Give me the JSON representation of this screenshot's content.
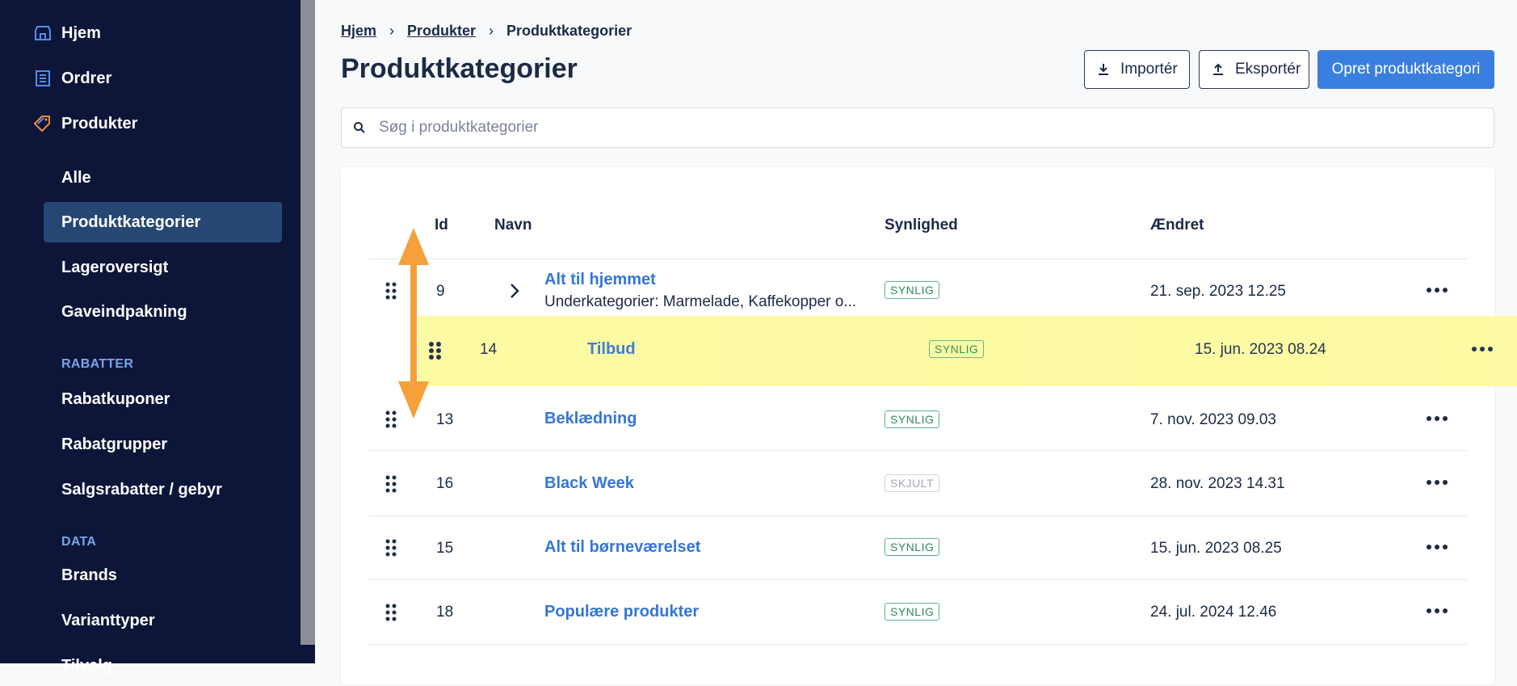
{
  "sidebar": {
    "nav": [
      {
        "label": "Hjem",
        "icon": "store-icon"
      },
      {
        "label": "Ordrer",
        "icon": "orders-icon"
      },
      {
        "label": "Produkter",
        "icon": "tag-icon"
      }
    ],
    "sub": [
      "Alle",
      "Produktkategorier",
      "Lageroversigt",
      "Gaveindpakning"
    ],
    "section_rabatter": "RABATTER",
    "rabatter": [
      "Rabatkuponer",
      "Rabatgrupper",
      "Salgsrabatter / gebyr"
    ],
    "section_data": "DATA",
    "data": [
      "Brands",
      "Varianttyper",
      "Tilvalg"
    ]
  },
  "breadcrumb": {
    "home": "Hjem",
    "products": "Produkter",
    "current": "Produktkategorier"
  },
  "page": {
    "title": "Produktkategorier",
    "import_label": "Importér",
    "export_label": "Eksportér",
    "create_label": "Opret produktkategori"
  },
  "search": {
    "placeholder": "Søg i produktkategorier"
  },
  "table": {
    "headers": {
      "id": "Id",
      "name": "Navn",
      "visibility": "Synlighed",
      "changed": "Ændret"
    },
    "rows": [
      {
        "id": "9",
        "name": "Alt til hjemmet",
        "sub": "Underkategorier: Marmelade, Kaffekopper o...",
        "visibility": "SYNLIG",
        "changed": "21. sep. 2023 12.25"
      },
      {
        "id": "13",
        "name": "Beklædning",
        "visibility": "SYNLIG",
        "changed": "7. nov. 2023 09.03"
      },
      {
        "id": "16",
        "name": "Black Week",
        "visibility": "SKJULT",
        "changed": "28. nov. 2023 14.31"
      },
      {
        "id": "15",
        "name": "Alt til børneværelset",
        "visibility": "SYNLIG",
        "changed": "15. jun. 2023 08.25"
      },
      {
        "id": "18",
        "name": "Populære produkter",
        "visibility": "SYNLIG",
        "changed": "24. jul. 2024 12.46"
      }
    ],
    "dragging": {
      "id": "14",
      "name": "Tilbud",
      "visibility": "SYNLIG",
      "changed": "15. jun. 2023 08.24"
    }
  },
  "colors": {
    "sidebar_bg": "#0d1539",
    "accent": "#3a7fe0",
    "link": "#3476d6",
    "drag_highlight": "#fdfaa0",
    "arrow": "#f5a03a"
  }
}
